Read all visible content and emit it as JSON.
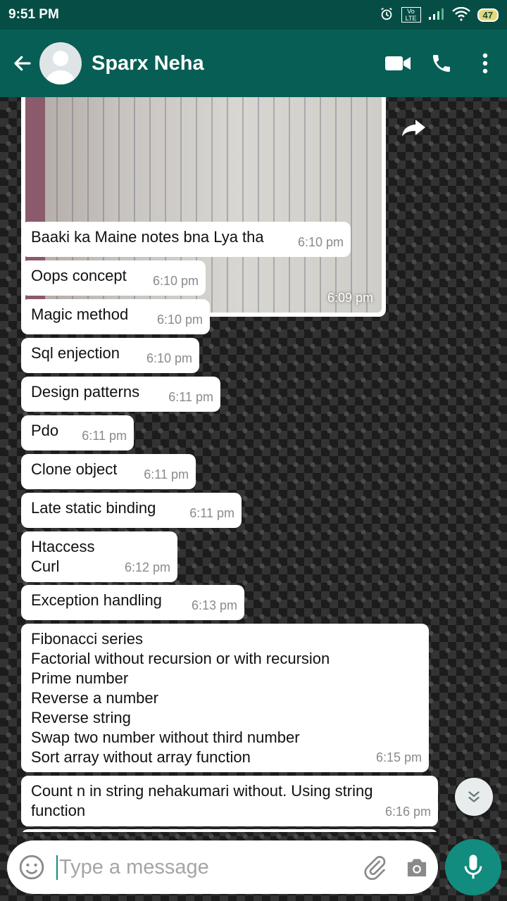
{
  "status_bar": {
    "time": "9:51 PM",
    "network_label": "Vo LTE",
    "battery": "47"
  },
  "header": {
    "contact_name": "Sparx Neha"
  },
  "image_message": {
    "time": "6:09 pm"
  },
  "messages": [
    {
      "text": "Baaki ka Maine notes bna Lya tha",
      "time": "6:10 pm"
    },
    {
      "text": "Oops concept",
      "time": "6:10 pm"
    },
    {
      "text": "Magic method",
      "time": "6:10 pm"
    },
    {
      "text": "Sql enjection",
      "time": "6:10 pm"
    },
    {
      "text": "Design patterns",
      "time": "6:11 pm"
    },
    {
      "text": "Pdo",
      "time": "6:11 pm"
    },
    {
      "text": "Clone object",
      "time": "6:11 pm"
    },
    {
      "text": "Late static binding",
      "time": "6:11 pm"
    },
    {
      "text": "Htaccess\nCurl",
      "time": "6:12 pm"
    },
    {
      "text": "Exception handling",
      "time": "6:13 pm"
    },
    {
      "text": "Fibonacci series\nFactorial without recursion or with recursion\nPrime number\nReverse a number\nReverse string\nSwap two number without third number\nSort array without array function",
      "time": "6:15 pm"
    },
    {
      "text": "Count n in string nehakumari without. Using string\nfunction",
      "time": "6:16 pm"
    }
  ],
  "composer": {
    "placeholder": "Type a message"
  },
  "colors": {
    "header": "#075e54",
    "status_bar": "#064d45",
    "accent": "#128c7e",
    "bubble": "#ffffff"
  }
}
